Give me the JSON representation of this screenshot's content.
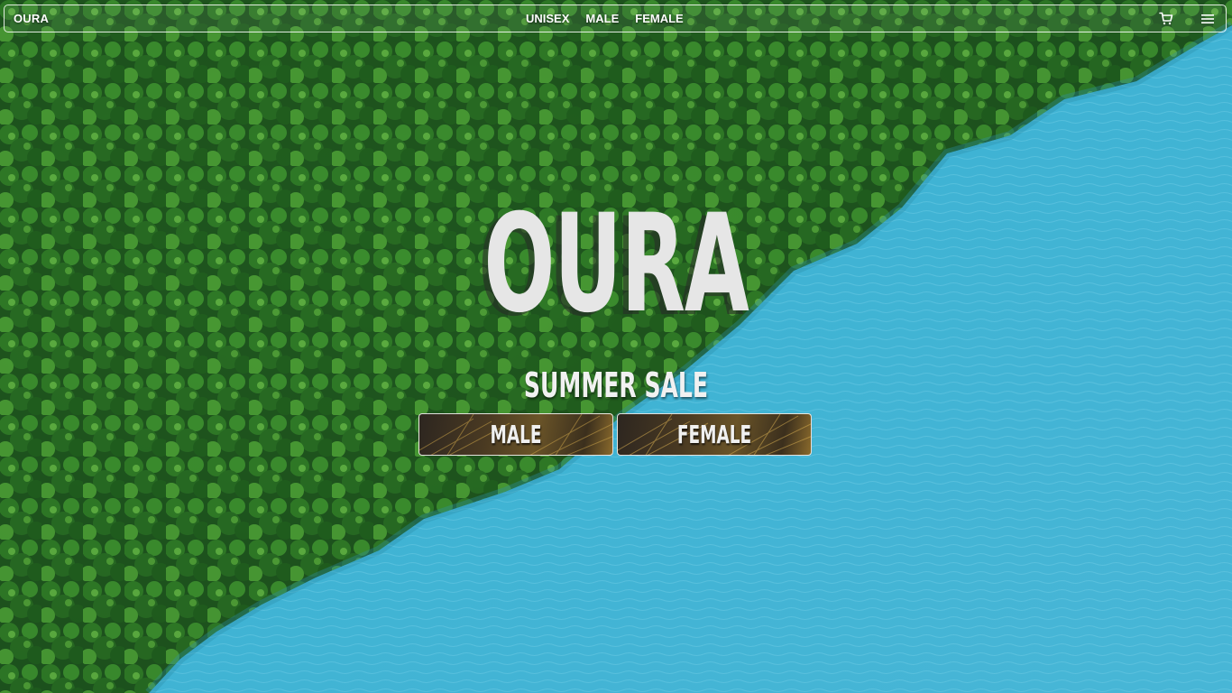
{
  "navbar": {
    "brand": "OURA",
    "links": [
      "UNISEX",
      "MALE",
      "FEMALE"
    ],
    "icons": [
      "cart-icon",
      "menu-icon"
    ]
  },
  "hero": {
    "title": "OURA",
    "subtitle": "SUMMER SALE",
    "buttons": [
      "MALE",
      "FEMALE"
    ]
  },
  "colors": {
    "forest": "#1f5a1c",
    "forest_light": "#3f8a2c",
    "water": "#3fb3d4",
    "water_light": "#63c6e2",
    "text": "#e6e6e6"
  }
}
